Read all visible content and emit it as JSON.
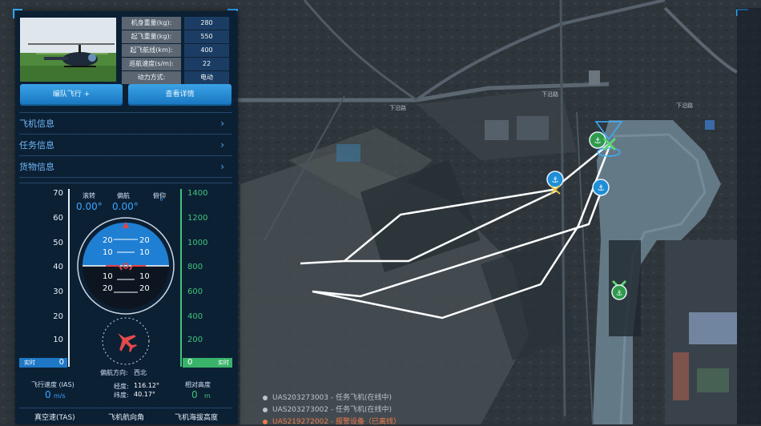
{
  "aircraft": {
    "specs": [
      {
        "label": "机身重量(kg):",
        "value": "280"
      },
      {
        "label": "起飞重量(kg):",
        "value": "550"
      },
      {
        "label": "起飞航线(km):",
        "value": "400"
      },
      {
        "label": "巡航速度(s/m):",
        "value": "22"
      },
      {
        "label": "动力方式:",
        "value": "电动"
      }
    ],
    "buttons": {
      "formation": "编队飞行 +",
      "details": "查看详情"
    }
  },
  "sections": [
    "飞机信息",
    "任务信息",
    "货物信息"
  ],
  "instrument": {
    "left_scale": [
      "70",
      "60",
      "50",
      "40",
      "30",
      "20",
      "10",
      "0"
    ],
    "right_scale": [
      "1400",
      "1200",
      "1000",
      "800",
      "600",
      "400",
      "200",
      "0"
    ],
    "roll_label": "滚转",
    "roll_value": "0.00°",
    "yaw_label": "偏航",
    "yaw_value": "0.00°",
    "pitch_label": "俯仰",
    "pitch_value": "°",
    "pitch_ladder_top": [
      "20",
      "10"
    ],
    "pitch_ladder_bottom": [
      "10",
      "20"
    ],
    "realtime_left": "实时",
    "realtime_right": "实时",
    "left_indicator": "0",
    "right_indicator": "0",
    "heading_label": "偏航方向:",
    "heading_value": "西北",
    "airspeed_label": "飞行速度 (IAS)",
    "airspeed_value": "0",
    "airspeed_unit": "m/s",
    "lon_label": "经度:",
    "lon_value": "116.12°",
    "lat_label": "纬度:",
    "lat_value": "40.17°",
    "alt_label": "相对高度",
    "alt_value": "0",
    "alt_unit": "m",
    "bottom": [
      "真空速(TAS)",
      "飞机航向角",
      "飞机海拔高度"
    ]
  },
  "map": {
    "road_labels": [
      "下沿路",
      "下沿路",
      "下沿路"
    ],
    "legend": [
      {
        "text": "UAS203273003 - 任务飞机(在线中)",
        "color": "#b7c4cc"
      },
      {
        "text": "UAS203273002 - 任务飞机(在线中)",
        "color": "#b7c4cc"
      },
      {
        "text": "UAS219272002 - 报警设备（已离线）",
        "color": "#f07a4a"
      }
    ]
  },
  "colors": {
    "accent": "#2fa6ff",
    "route": "#ffffff",
    "green_scale": "#3fc47a",
    "panel": "#0a1e34"
  }
}
